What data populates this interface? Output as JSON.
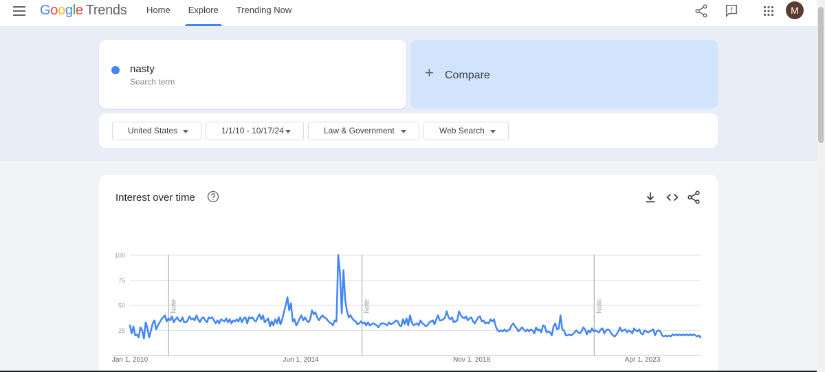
{
  "header": {
    "logo_google": [
      "G",
      "o",
      "o",
      "g",
      "l",
      "e"
    ],
    "logo_trends": "Trends",
    "nav": [
      {
        "label": "Home",
        "active": false
      },
      {
        "label": "Explore",
        "active": true
      },
      {
        "label": "Trending Now",
        "active": false
      }
    ],
    "avatar_letter": "M",
    "icons": [
      "share-icon",
      "feedback-icon",
      "apps-grid-icon"
    ]
  },
  "search": {
    "term": "nasty",
    "term_type": "Search term",
    "term_color": "#4285f4",
    "compare_label": "Compare"
  },
  "filters": [
    {
      "label": "United States"
    },
    {
      "label": "1/1/10 - 10/17/24"
    },
    {
      "label": "Law & Government"
    },
    {
      "label": "Web Search"
    }
  ],
  "chart_card": {
    "title": "Interest over time",
    "icons": [
      "download-icon",
      "embed-code-icon",
      "share-icon"
    ]
  },
  "chart_data": {
    "type": "line",
    "x_start": "2010-01",
    "x_end": "2024-10",
    "x_tick_labels": [
      "Jan 1, 2010",
      "Jun 1, 2014",
      "Nov 1, 2018",
      "Apr 1, 2023"
    ],
    "x_tick_dates": [
      "2010-01",
      "2014-06",
      "2018-11",
      "2023-04"
    ],
    "y_ticks": [
      25,
      50,
      75,
      100
    ],
    "ylim": [
      0,
      100
    ],
    "note_label": "Note",
    "note_dates": [
      "2011-01",
      "2016-01",
      "2022-01"
    ],
    "series": [
      {
        "color": "#4285f4",
        "values": [
          30,
          22,
          29,
          20,
          21,
          18,
          28,
          25,
          17,
          33,
          27,
          18,
          25,
          32,
          35,
          26,
          30,
          33,
          36,
          38,
          40,
          34,
          37,
          35,
          39,
          33,
          36,
          38,
          35,
          34,
          38,
          33,
          33,
          35,
          39,
          36,
          37,
          35,
          40,
          36,
          33,
          37,
          38,
          35,
          33,
          38,
          37,
          38,
          35,
          32,
          35,
          32,
          36,
          35,
          34,
          37,
          33,
          36,
          32,
          35,
          34,
          36,
          34,
          38,
          33,
          37,
          38,
          32,
          38,
          37,
          38,
          35,
          34,
          38,
          41,
          36,
          40,
          33,
          35,
          37,
          29,
          34,
          30,
          36,
          32,
          38,
          31,
          36,
          43,
          50,
          58,
          45,
          52,
          34,
          36,
          30,
          33,
          37,
          40,
          35,
          38,
          35,
          33,
          36,
          45,
          41,
          43,
          38,
          35,
          38,
          40,
          38,
          37,
          35,
          33,
          32,
          30,
          35,
          34,
          100,
          82,
          42,
          85,
          55,
          44,
          38,
          40,
          37,
          35,
          34,
          31,
          32,
          34,
          32,
          33,
          30,
          33,
          30,
          31,
          32,
          31,
          30,
          28,
          31,
          32,
          32,
          31,
          30,
          33,
          31,
          32,
          33,
          35,
          34,
          30,
          29,
          36,
          31,
          37,
          30,
          40,
          33,
          30,
          31,
          32,
          30,
          35,
          32,
          31,
          29,
          30,
          33,
          34,
          35,
          31,
          36,
          40,
          35,
          35,
          36,
          38,
          44,
          38,
          36,
          38,
          33,
          34,
          35,
          44,
          40,
          38,
          37,
          39,
          35,
          37,
          38,
          34,
          32,
          35,
          38,
          39,
          34,
          35,
          32,
          33,
          32,
          36,
          34,
          36,
          29,
          25,
          24,
          25,
          24,
          26,
          24,
          25,
          26,
          30,
          32,
          29,
          27,
          24,
          26,
          28,
          26,
          24,
          26,
          24,
          26,
          25,
          22,
          28,
          25,
          26,
          23,
          30,
          29,
          23,
          24,
          23,
          20,
          29,
          32,
          26,
          27,
          40,
          26,
          25,
          20,
          20,
          21,
          20,
          21,
          23,
          25,
          23,
          22,
          24,
          28,
          26,
          21,
          25,
          23,
          27,
          24,
          25,
          24,
          23,
          26,
          27,
          22,
          25,
          26,
          25,
          22,
          20,
          19,
          21,
          24,
          28,
          24,
          25,
          26,
          23,
          25,
          24,
          22,
          27,
          25,
          24,
          26,
          22,
          21,
          25,
          24,
          23,
          24,
          25,
          26,
          20,
          24,
          25,
          24,
          20,
          19,
          20,
          19,
          20,
          19,
          21,
          20,
          21,
          20,
          21,
          20,
          21,
          20,
          21,
          20,
          21,
          20,
          21,
          20,
          19,
          20,
          18
        ]
      }
    ]
  }
}
